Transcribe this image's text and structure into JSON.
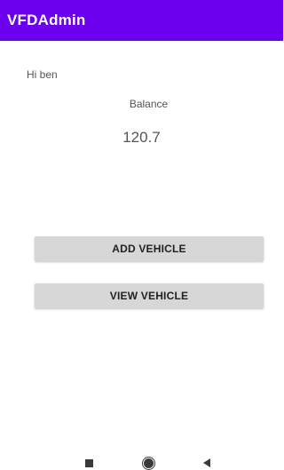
{
  "app_bar": {
    "title": "VFDAdmin",
    "background_color": "#6a00ee"
  },
  "main": {
    "greeting": "Hi ben",
    "balance_label": "Balance",
    "balance_value": "120.7",
    "buttons": [
      {
        "label": "ADD VEHICLE"
      },
      {
        "label": "VIEW VEHICLE"
      }
    ]
  },
  "nav_bar": {
    "icons": [
      "recents-icon",
      "home-icon",
      "back-icon"
    ]
  }
}
